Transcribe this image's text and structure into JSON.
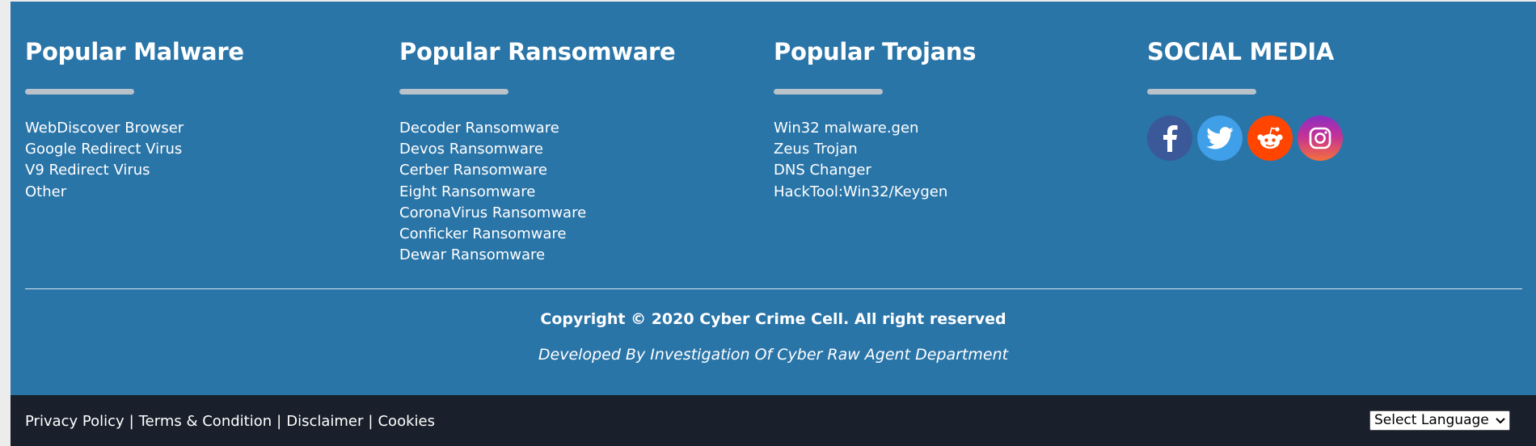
{
  "columns": [
    {
      "title": "Popular Malware",
      "links": [
        "WebDiscover Browser",
        "Google Redirect Virus",
        "V9 Redirect Virus",
        "Other"
      ]
    },
    {
      "title": "Popular Ransomware",
      "links": [
        "Decoder Ransomware",
        "Devos Ransomware",
        "Cerber Ransomware",
        "Eight Ransomware",
        "CoronaVirus Ransomware",
        "Conficker Ransomware",
        "Dewar Ransomware"
      ]
    },
    {
      "title": "Popular Trojans",
      "links": [
        "Win32 malware.gen",
        "Zeus Trojan",
        "DNS Changer",
        "HackTool:Win32/Keygen"
      ]
    }
  ],
  "social": {
    "title": "SOCIAL MEDIA",
    "icons": [
      "facebook-icon",
      "twitter-icon",
      "reddit-icon",
      "instagram-icon"
    ]
  },
  "copyright": "Copyright © 2020 Cyber Crime Cell. All right reserved",
  "developed_by": "Developed By Investigation Of Cyber Raw Agent Department",
  "bottom": {
    "privacy": "Privacy Policy",
    "terms": "Terms & Condition",
    "disclaimer": "Disclaimer",
    "cookies": "Cookies",
    "separator": "|",
    "language_select": "Select Language"
  },
  "colors": {
    "footer_bg": "#2a75a8",
    "bottom_bar_bg": "#19202b",
    "facebook": "#3b5998",
    "twitter": "#3f9fe8",
    "reddit": "#ff4500"
  }
}
